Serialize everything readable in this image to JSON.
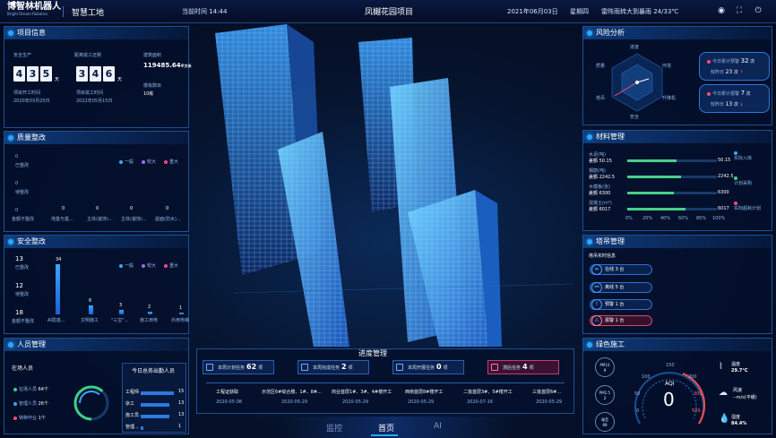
{
  "header": {
    "logo": "博智林机器人",
    "logo_sub": "Bright Dream Robotics",
    "app": "智慧工地",
    "time": "当前时间 14:44",
    "project": "凤樾花园项目",
    "date": "2021年06月03日",
    "weekday": "星期四",
    "weather": "雷阵雨转大到暴雨 24/33℃"
  },
  "project_info": {
    "title": "项目信息",
    "safe_label": "安全生产",
    "safe_digits": [
      "4",
      "3",
      "5"
    ],
    "safe_unit": "天",
    "start_label": "项目开工时间",
    "start_date": "2020年03月25日",
    "remain_label": "距离竣工还剩",
    "remain_digits": [
      "3",
      "4",
      "6"
    ],
    "remain_unit": "天",
    "end_label": "项目竣工时间",
    "end_date": "2022年05月15日",
    "area_label": "建筑面积",
    "area_value": "119485.64",
    "area_unit": "平方米",
    "build_label": "楼栋数目",
    "build_value": "10栋"
  },
  "quality": {
    "title": "质量整改",
    "legend": [
      "一般",
      "较大",
      "重大"
    ],
    "yticks": [
      "0",
      "0",
      "0"
    ],
    "ylabels": [
      "已整改",
      "待整改",
      "金额不整改"
    ],
    "values": [
      "0",
      "0",
      "0",
      "0"
    ],
    "cats": [
      "地基与基...",
      "主体(装饰)...",
      "主体(装饰)...",
      "屋面(防水)..."
    ]
  },
  "safety": {
    "title": "安全整改",
    "legend": [
      "一般",
      "较大",
      "重大"
    ],
    "yticks": [
      "13",
      "12",
      "18"
    ],
    "ylabels": [
      "已整改",
      "待整改",
      "金额不整改"
    ],
    "chart_data": {
      "type": "bar",
      "categories": [
        "AI隐患...",
        "文明施工",
        "\"三宝\"...",
        "施工用电",
        "外用电梯"
      ],
      "values": [
        34,
        6,
        3,
        2,
        1
      ]
    }
  },
  "personnel": {
    "title": "人员管理",
    "in_label": "在场人员",
    "groups": [
      {
        "label": "在场人员",
        "count": "64个"
      },
      {
        "label": "管理人员",
        "count": "26个"
      },
      {
        "label": "特种作业",
        "count": "1个"
      }
    ],
    "table_title": "今日总务出勤人员",
    "rows": [
      {
        "name": "工程师",
        "val": "15"
      },
      {
        "name": "杂工",
        "val": "13"
      },
      {
        "name": "施工员",
        "val": "13"
      },
      {
        "name": "管理...",
        "val": "1"
      }
    ]
  },
  "progress": {
    "title": "进度管理",
    "stats": [
      {
        "label": "本周计划任务",
        "value": "62",
        "unit": "项"
      },
      {
        "label": "本周完成任务",
        "value": "2",
        "unit": "项"
      },
      {
        "label": "本周开展任务",
        "value": "0",
        "unit": "项"
      },
      {
        "label": "滞后任务",
        "value": "4",
        "unit": "项"
      }
    ],
    "timeline": [
      {
        "task": "工程证获取",
        "date": "2020-05-08"
      },
      {
        "task": "示范区6#综合楼、1#、8#...",
        "date": "2020-05-29"
      },
      {
        "task": "商业首层1#、3#、4#楼开工",
        "date": "2020-05-29"
      },
      {
        "task": "西南首层8#楼开工",
        "date": "2020-05-29"
      },
      {
        "task": "二批首层3#、5#楼开工",
        "date": "2020-07-16"
      },
      {
        "task": "三批首层6#...",
        "date": "2020-05-29"
      }
    ]
  },
  "nav": {
    "items": [
      "监控",
      "首页",
      "AI"
    ]
  },
  "risk": {
    "title": "风险分析",
    "axes": [
      "进度",
      "环境",
      "升降机",
      "安全",
      "塔吊",
      "质量"
    ],
    "today_label": "今日累计预警",
    "today_value": "32",
    "today_unit": "次",
    "prev_label": "较昨日",
    "prev_value": "23",
    "prev_unit": "次",
    "today2_label": "今日累计报警",
    "today2_value": "7",
    "today2_unit": "次",
    "prev2_label": "较昨日",
    "prev2_value": "13",
    "prev2_unit": "次"
  },
  "material": {
    "title": "材料管理",
    "items": [
      {
        "name": "水泥(吨)",
        "sub": "差额 50.15",
        "value": "50.15",
        "fill": 0.55
      },
      {
        "name": "钢筋(吨)",
        "sub": "差额 2242.5",
        "value": "2242.5",
        "fill": 0.6
      },
      {
        "name": "木模板(张)",
        "sub": "差额 6300",
        "value": "6300",
        "fill": 0.52
      },
      {
        "name": "混凝土(m³)",
        "sub": "差额 6017",
        "value": "6017",
        "fill": 0.65
      }
    ],
    "ticks": [
      "0%",
      "20%",
      "40%",
      "60%",
      "80%",
      "100%"
    ],
    "legend": [
      "实际入库",
      "计划采购",
      "实际超耗计划"
    ]
  },
  "crane": {
    "title": "塔吊管理",
    "sub": "塔吊实时信息",
    "items": [
      {
        "label": "在线 3 台"
      },
      {
        "label": "离线 5 台"
      },
      {
        "label": "预警 1 台"
      },
      {
        "label": "报警 1 台"
      }
    ]
  },
  "green": {
    "title": "绿色施工",
    "pm10_label": "PM10",
    "pm10_value": "9",
    "pm25_label": "PM2.5",
    "pm25_value": "2",
    "noise_label": "噪音",
    "noise_value": "69",
    "aqi_label": "AQI",
    "aqi_value": "0",
    "gauge_ticks": [
      "0",
      "50",
      "100",
      "150",
      "200",
      "300",
      "500"
    ],
    "temp_label": "温度",
    "temp_value": "29.7°C",
    "wind_label": "风速",
    "wind_value": "--m/s(平缓)",
    "hum_label": "湿度",
    "hum_value": "84.4%"
  }
}
